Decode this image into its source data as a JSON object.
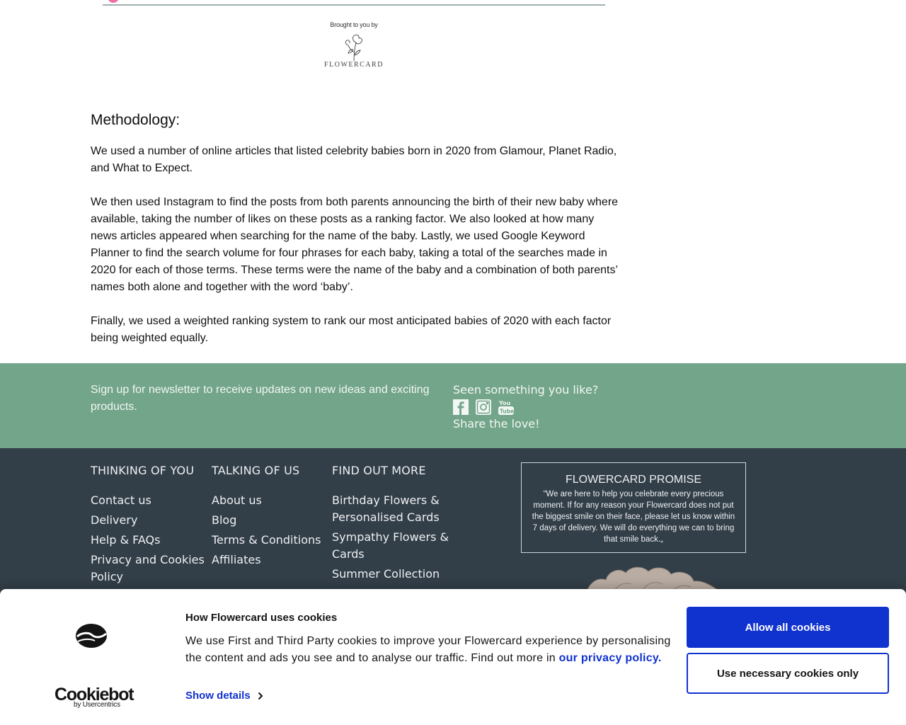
{
  "article": {
    "brought_by": "Brought to you by",
    "brand_logo_text": "FLOWERCARD",
    "heading": "Methodology:",
    "paragraphs": [
      "We used a number of online articles that listed celebrity babies born in 2020 from Glamour, Planet Radio, and What to Expect.",
      "We then used Instagram to find the posts from both parents announcing the birth of their new baby where available, taking the number of likes on these posts as a ranking factor. We also looked at how many news articles appeared when searching for the name of the baby. Lastly, we used Google Keyword Planner to find the search volume for four phrases for each baby, taking a total of the searches made in 2020 for each of those terms. These terms were the name of the baby and a combination of both parents’ names both alone and together with the word ‘baby’.",
      "Finally, we used a weighted ranking system to rank our most anticipated babies of 2020 with each factor being weighted equally."
    ]
  },
  "newsletter": {
    "text": "Sign up for newsletter to receive updates on new ideas and exciting products.",
    "social_heading": "Seen something you like?",
    "social_icons": [
      "facebook-icon",
      "instagram-icon",
      "youtube-icon"
    ],
    "share_text": "Share the love!"
  },
  "footer": {
    "columns": [
      {
        "heading": "THINKING OF YOU",
        "links": [
          "Contact us",
          "Delivery",
          "Help & FAQs",
          "Privacy and Cookies Policy"
        ]
      },
      {
        "heading": "TALKING OF US",
        "links": [
          "About us",
          "Blog",
          "Terms & Conditions",
          "Affiliates"
        ]
      },
      {
        "heading": "FIND OUT MORE",
        "links": [
          "Birthday Flowers & Personalised Cards",
          "Sympathy Flowers & Cards",
          "Summer Collection"
        ]
      }
    ],
    "promise_title": "FLOWERCARD PROMISE",
    "promise_text": "“We are here to help you celebrate every precious moment. If for any reason your Flowercard does not put the biggest smile on their face, please let us know within 7 days of delivery. We will do everything we can to bring that smile back.„"
  },
  "cookie_banner": {
    "brand": "Cookiebot",
    "brand_sub": "by Usercentrics",
    "title": "How Flowercard uses cookies",
    "text": "We use First and Third Party cookies to improve your Flowercard experience by personalising the content and ads you see and to analyse our traffic. Find out more in ",
    "link_text": "our privacy policy.",
    "show_details": "Show details",
    "allow_all": "Allow all cookies",
    "necessary_only": "Use necessary cookies only"
  },
  "colors": {
    "newsletter_bg": "#73a58a",
    "footer_bg": "#323e48",
    "accent_blue": "#1032cf"
  }
}
